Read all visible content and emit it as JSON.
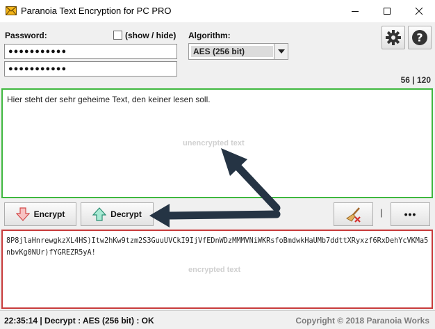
{
  "window": {
    "title": "Paranoia Text Encryption for PC PRO",
    "icons": {
      "app": "envelope-icon",
      "minimize": "minimize-icon",
      "maximize": "maximize-icon",
      "close": "close-icon"
    }
  },
  "password": {
    "label": "Password:",
    "field1_value": "●●●●●●●●●●●",
    "field2_value": "●●●●●●●●●●●",
    "show_hide_label": "(show / hide)",
    "show_hide_checked": false
  },
  "algorithm": {
    "label": "Algorithm:",
    "selected": "AES (256 bit)"
  },
  "toolbar_icons": {
    "settings": "gear-icon",
    "help": "question-icon"
  },
  "counter": "56 | 120",
  "plain": {
    "text": "Hier steht der sehr geheime Text, den keiner lesen soll.",
    "placeholder": "unencrypted text",
    "border_color": "#3fb83f"
  },
  "actions": {
    "encrypt_label": "Encrypt",
    "decrypt_label": "Decrypt",
    "clear_icon": "broom-icon",
    "separator": "|",
    "more_label": "•••"
  },
  "encrypted": {
    "text": "8P8jlaHnrewgkzXL4HS)Itw2hKw9tzm2S3GuuUVCkI9IjVfEDnWDzMMMVNiWKRsfoBmdwkHaUMb7ddttXRyxzf6RxDehYcVKMa5nbvKg0NUr)fYGREZR5yA!",
    "placeholder": "encrypted text",
    "border_color": "#c83a3a"
  },
  "status": {
    "text": "22:35:14 | Decrypt : AES (256 bit) : OK",
    "copyright": "Copyright © 2018 Paranoia Works"
  }
}
